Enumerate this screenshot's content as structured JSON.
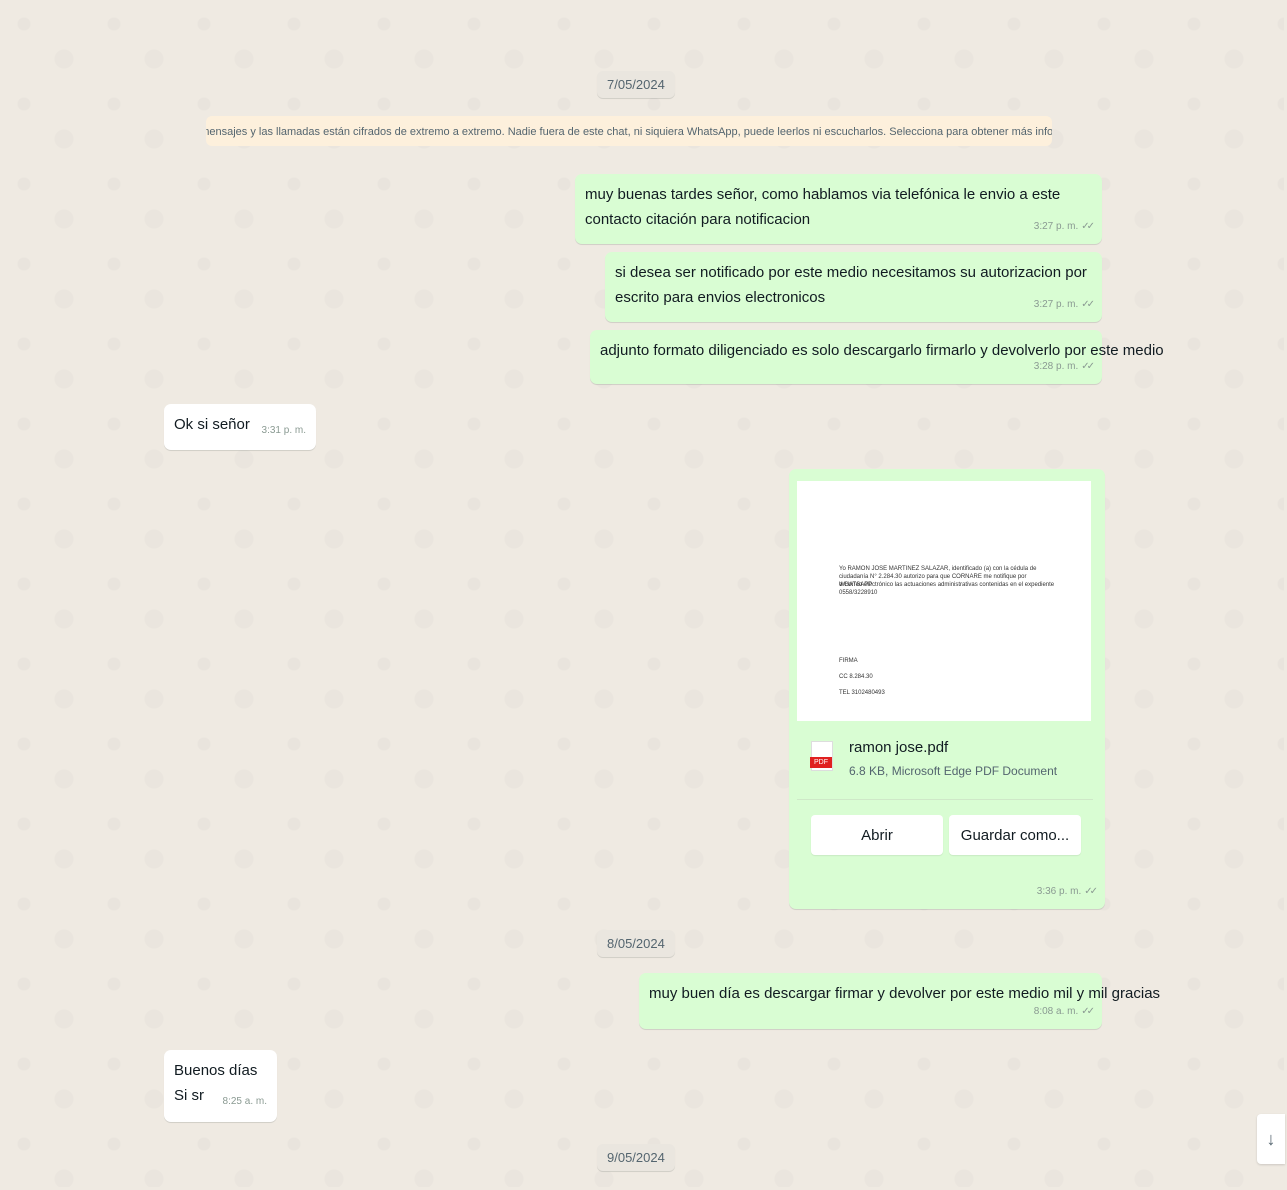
{
  "dates": {
    "d1": "7/05/2024",
    "d2": "8/05/2024",
    "d3": "9/05/2024"
  },
  "encryption_notice": "🔒 Los mensajes y las llamadas están cifrados de extremo a extremo. Nadie fuera de este chat, ni siquiera WhatsApp, puede leerlos ni escucharlos. Selecciona para obtener más información.",
  "messages": [
    {
      "text": "muy buenas tardes señor, como hablamos via telefónica le envio a este contacto citación para notificacion",
      "time": "3:27 p. m."
    },
    {
      "text": "si desea ser notificado por este medio necesitamos su autorizacion por escrito para envios electronicos",
      "time": "3:27 p. m."
    },
    {
      "text": "adjunto formato diligenciado es solo descargarlo firmarlo y devolverlo por este medio",
      "time": "3:28 p. m."
    },
    {
      "text": "Ok si señor",
      "time": "3:31 p. m."
    },
    {
      "text": "muy buen día  es descargar firmar y devolver por este medio mil y mil gracias",
      "time": "8:08 a. m."
    },
    {
      "text": "Buenos días\nSi sr",
      "time": "8:25 a. m."
    }
  ],
  "document": {
    "preview_lines": [
      "Yo RAMON JOSE MARTINEZ SALAZAR, identificado (a) con la cédula de",
      "ciudadanía N° 2.284.30 autorizo para que CORNARE me notifique por WHATSAPP",
      "o Correo electrónico las actuaciones administrativas contenidas en el expediente",
      "0558/3228910",
      "FIRMA",
      "CC 8.284.30",
      "TEL 3102480493"
    ],
    "file_name": "ramon jose.pdf",
    "file_info": "6.8 KB, Microsoft Edge PDF Document",
    "pdf_tag": "PDF",
    "open_label": "Abrir",
    "save_label": "Guardar como...",
    "time": "3:36 p. m."
  },
  "icons": {
    "ticks": "double-check-icon",
    "scroll": "arrow-down-icon",
    "lock": "lock-icon"
  },
  "glyphs": {
    "ticks": "✓✓",
    "scroll": "↓"
  }
}
